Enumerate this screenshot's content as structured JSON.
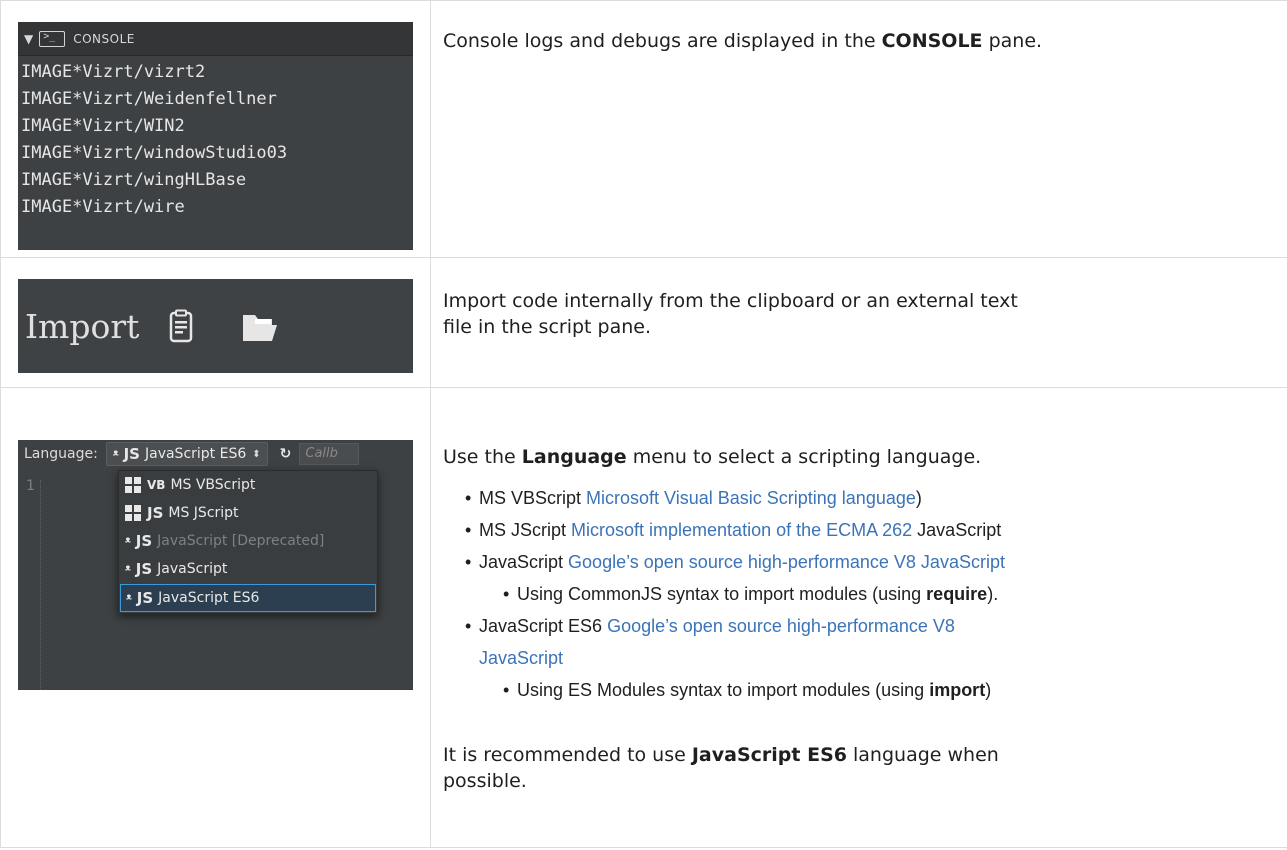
{
  "console": {
    "title": "CONSOLE",
    "lines": [
      "IMAGE*Vizrt/vizrt2",
      "IMAGE*Vizrt/Weidenfellner",
      "IMAGE*Vizrt/WIN2",
      "IMAGE*Vizrt/windowStudio03",
      "IMAGE*Vizrt/wingHLBase",
      "IMAGE*Vizrt/wire"
    ],
    "description_before": "Console logs and debugs are displayed in the ",
    "description_bold": "CONSOLE",
    "description_after": " pane."
  },
  "import": {
    "label": "Import",
    "description_line1": "Import code internally from the clipboard or an external text",
    "description_line2": "file in the script pane."
  },
  "language": {
    "label": "Language:",
    "selected": "JavaScript ES6",
    "callback_placeholder": "Callb",
    "gutter_number": "1",
    "menu_items": [
      {
        "badge": "VB",
        "label": "MS VBScript"
      },
      {
        "badge": "JS",
        "label": "MS JScript"
      },
      {
        "badge": "JS",
        "label": "JavaScript [Deprecated]"
      },
      {
        "badge": "JS",
        "label": "JavaScript"
      },
      {
        "badge": "JS",
        "label": "JavaScript ES6"
      }
    ],
    "intro_before": "Use the ",
    "intro_bold": "Language",
    "intro_after": " menu to select a scripting language.",
    "bullets": {
      "b1_name": "MS VBScript ",
      "b1_link": "Microsoft Visual Basic Scripting language",
      "b1_after": ")",
      "b2_name": "MS JScript ",
      "b2_link": "Microsoft implementation of the ECMA 262",
      "b2_after": " JavaScript",
      "b3_name": "JavaScript ",
      "b3_link": "Google’s open source high-performance V8 JavaScript",
      "b3_sub_before": "Using CommonJS syntax to import modules (using ",
      "b3_sub_bold": "require",
      "b3_sub_after": ").",
      "b4_name": "JavaScript ES6 ",
      "b4_link_line1": "Google’s open source high-performance V8",
      "b4_link_line2": "JavaScript",
      "b4_sub_before": "Using ES Modules syntax to import modules (using ",
      "b4_sub_bold": "import",
      "b4_sub_after": ")"
    },
    "rec_before": "It is recommended to use ",
    "rec_bold": "JavaScript ES6",
    "rec_after_line1": " language when",
    "rec_line2": "possible."
  },
  "colors": {
    "panel_bg": "#3e4143",
    "link": "#3b73b9",
    "selection_border": "#3c9ad8"
  }
}
